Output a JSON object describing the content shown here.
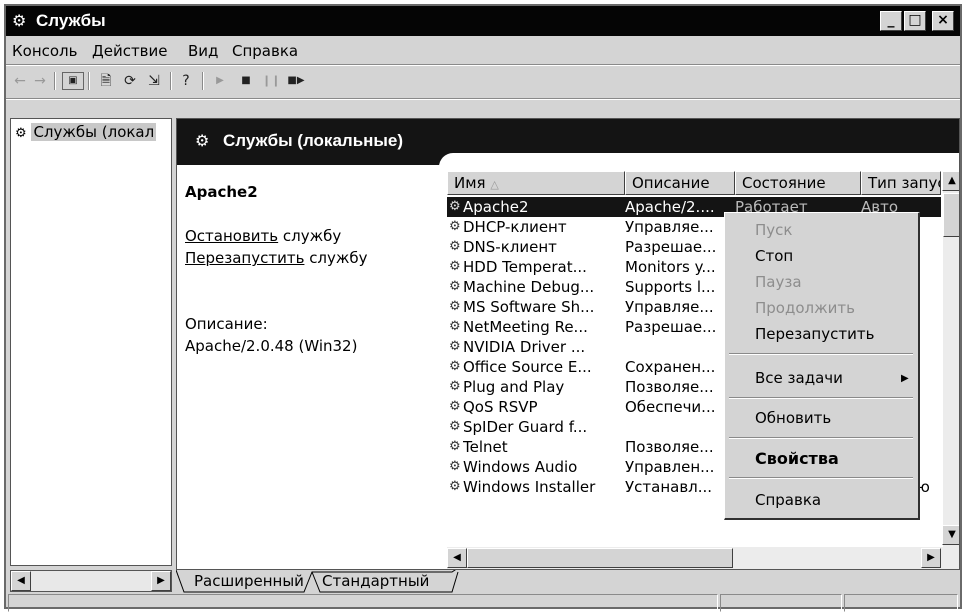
{
  "window": {
    "title": "Службы",
    "min": "_",
    "max": "□",
    "close": "×"
  },
  "menu": [
    "Консоль",
    "Действие",
    "Вид",
    "Справка"
  ],
  "tree": {
    "node": "Службы (локал"
  },
  "right_header": "Службы (локальные)",
  "extended": {
    "service_name": "Apache2",
    "stop_link": "Остановить",
    "stop_suffix": " службу",
    "restart_link": "Перезапустить",
    "restart_suffix": " службу",
    "desc_label": "Описание:",
    "desc_value": "Apache/2.0.48 (Win32)"
  },
  "columns": [
    "Имя",
    "Описание",
    "Состояние",
    "Тип запуска"
  ],
  "rows": [
    {
      "name": "Apache2",
      "desc": "Apache/2....",
      "state": "Работает",
      "type": "Авто"
    },
    {
      "name": "DHCP-клиент",
      "desc": "Управляе...",
      "state": "",
      "type": ""
    },
    {
      "name": "DNS-клиент",
      "desc": "Разрешае...",
      "state": "",
      "type": ""
    },
    {
      "name": "HDD Temperat...",
      "desc": "Monitors y...",
      "state": "",
      "type": ""
    },
    {
      "name": "Machine Debug...",
      "desc": "Supports l...",
      "state": "",
      "type": ""
    },
    {
      "name": "MS Software Sh...",
      "desc": "Управляе...",
      "state": "",
      "type": "ую"
    },
    {
      "name": "NetMeeting Re...",
      "desc": "Разрешае...",
      "state": "",
      "type": "ую"
    },
    {
      "name": "NVIDIA Driver ...",
      "desc": "",
      "state": "",
      "type": ""
    },
    {
      "name": "Office Source E...",
      "desc": "Сохранен...",
      "state": "",
      "type": "ую"
    },
    {
      "name": "Plug and Play",
      "desc": "Позволяе...",
      "state": "",
      "type": ""
    },
    {
      "name": "QoS RSVP",
      "desc": "Обеспечи...",
      "state": "",
      "type": "ую"
    },
    {
      "name": "SpIDer Guard f...",
      "desc": "",
      "state": "",
      "type": ""
    },
    {
      "name": "Telnet",
      "desc": "Позволяе...",
      "state": "",
      "type": "ую"
    },
    {
      "name": "Windows Audio",
      "desc": "Управлен...",
      "state": "",
      "type": ""
    },
    {
      "name": "Windows Installer",
      "desc": "Устанавл...",
      "state": "",
      "type": "Вручную"
    }
  ],
  "context_menu": {
    "start": "Пуск",
    "stop": "Стоп",
    "pause": "Пауза",
    "resume": "Продолжить",
    "restart": "Перезапустить",
    "all_tasks": "Все задачи",
    "refresh": "Обновить",
    "properties": "Свойства",
    "help": "Справка"
  },
  "tabs": [
    "Расширенный",
    "Стандартный"
  ]
}
